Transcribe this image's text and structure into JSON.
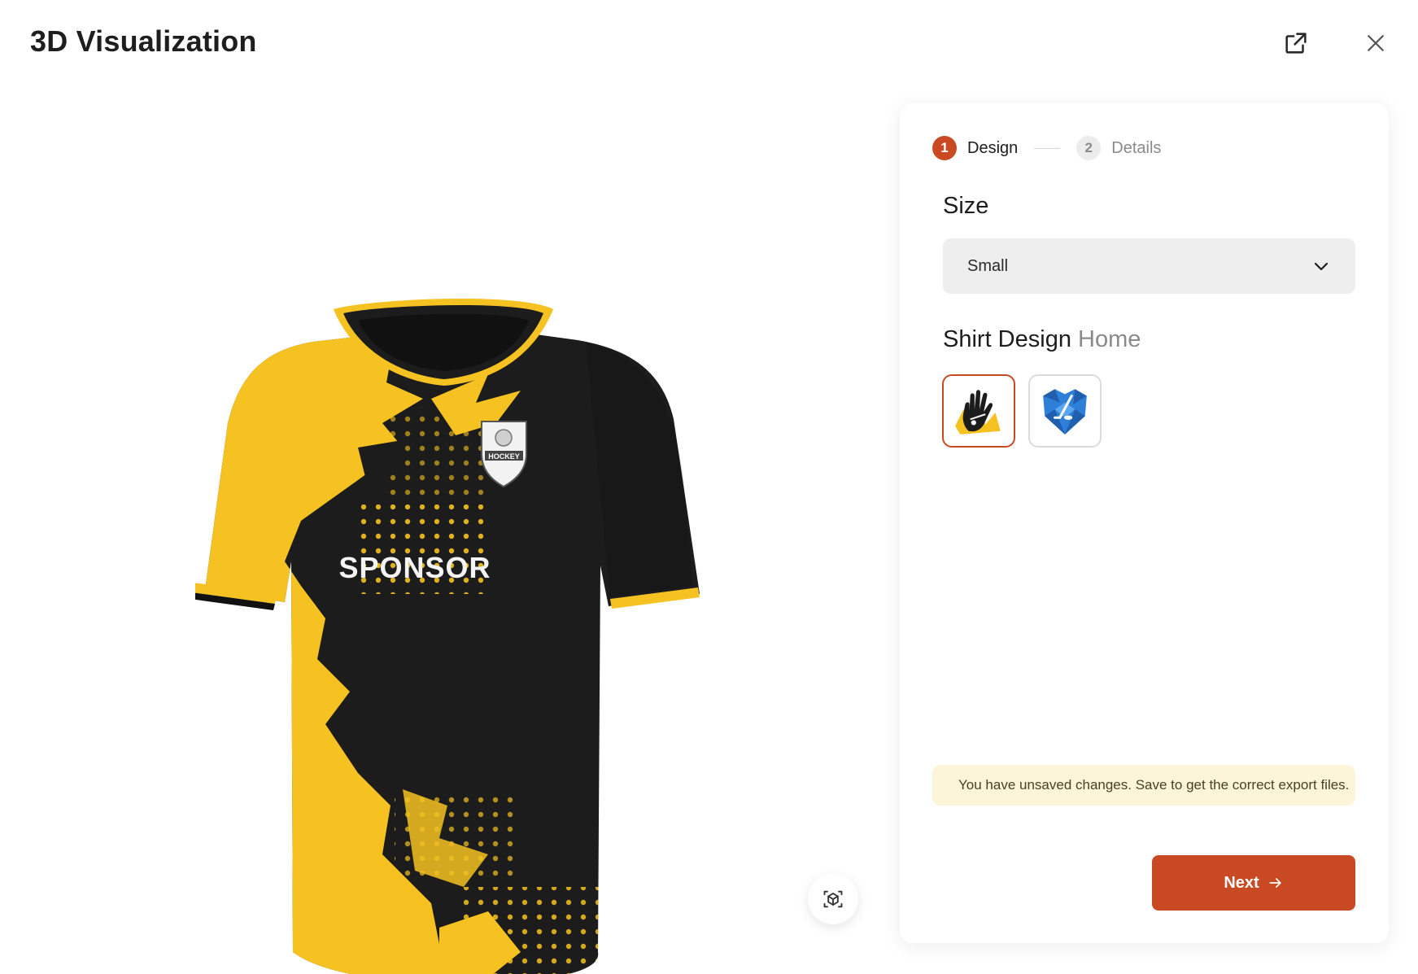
{
  "header": {
    "title": "3D Visualization",
    "external_icon": "external-link-icon",
    "close_icon": "close-icon"
  },
  "viewer": {
    "shirt": {
      "sponsor_text": "SPONSOR",
      "crest_text": "HOCKEY",
      "colors": {
        "primary": "#1c1c1c",
        "secondary": "#f5c221"
      }
    },
    "ar_icon": "ar-cube-icon"
  },
  "stepper": {
    "steps": [
      {
        "number": "1",
        "label": "Design",
        "active": true
      },
      {
        "number": "2",
        "label": "Details",
        "active": false
      }
    ]
  },
  "size": {
    "title": "Size",
    "selected": "Small",
    "icon": "chevron-down-icon"
  },
  "shirt_design": {
    "title": "Shirt Design",
    "variant": "Home",
    "options": [
      {
        "icon": "hockey-glove-icon",
        "selected": true
      },
      {
        "icon": "hockey-stick-shield-icon",
        "selected": false
      }
    ]
  },
  "notice": {
    "text": "You have unsaved changes. Save to get the correct export files."
  },
  "next_button": {
    "label": "Next",
    "icon": "arrow-right-icon"
  },
  "colors": {
    "accent": "#c94a22",
    "notice_bg": "#fcf5da",
    "select_bg": "#eeeeee"
  }
}
